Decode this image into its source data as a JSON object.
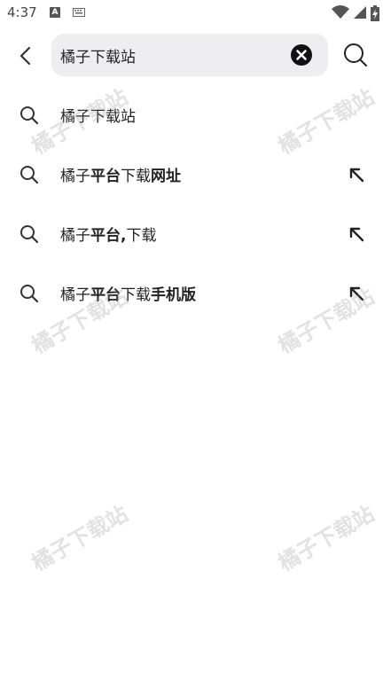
{
  "status_bar": {
    "time": "4:37",
    "notification_icon_letter": "A",
    "icons": [
      "keyboard-icon",
      "wifi-icon",
      "signal-icon",
      "battery-icon"
    ]
  },
  "search": {
    "value": "橘子下载站",
    "icons": {
      "back": "back-arrow-icon",
      "clear": "clear-icon",
      "search": "search-icon"
    }
  },
  "suggestions": [
    {
      "prefix": "橘子下载站",
      "bold": "",
      "rest": "",
      "has_fill_arrow": false
    },
    {
      "prefix": "橘子",
      "bold": "平台",
      "rest": "下载",
      "bold2": "网址",
      "has_fill_arrow": true
    },
    {
      "prefix": "橘子",
      "bold": "平台,",
      "rest": "下载",
      "bold2": "",
      "has_fill_arrow": true
    },
    {
      "prefix": "橘子",
      "bold": "平台",
      "rest": "下载",
      "bold2": "手机版",
      "has_fill_arrow": true
    }
  ],
  "watermark_text": "橘子下载站",
  "colors": {
    "search_bg": "#eeeef1",
    "text": "#222222",
    "icon": "#333333"
  }
}
